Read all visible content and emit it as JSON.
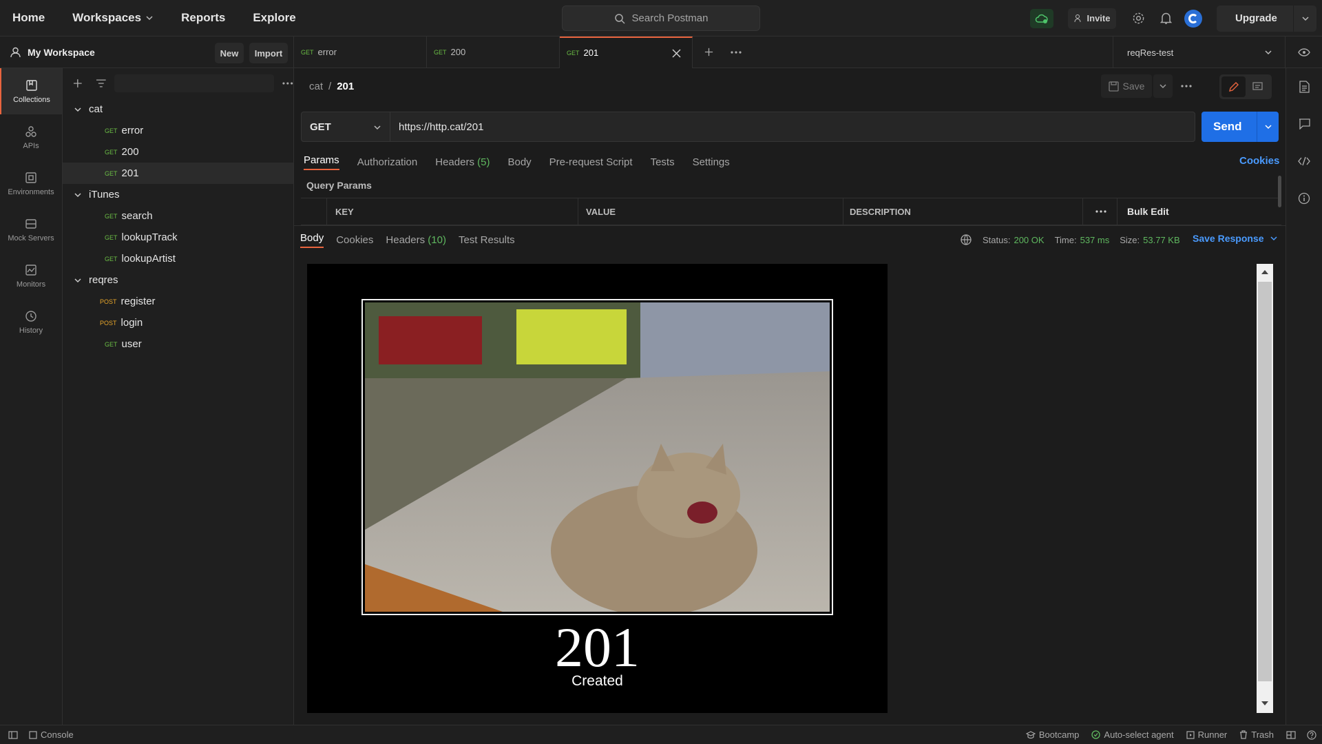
{
  "topnav": {
    "home": "Home",
    "workspaces": "Workspaces",
    "reports": "Reports",
    "explore": "Explore",
    "search_placeholder": "Search Postman",
    "invite": "Invite",
    "upgrade": "Upgrade"
  },
  "workspace": {
    "name": "My Workspace",
    "new": "New",
    "import": "Import"
  },
  "rail": [
    {
      "label": "Collections",
      "icon": "collections-icon"
    },
    {
      "label": "APIs",
      "icon": "apis-icon"
    },
    {
      "label": "Environments",
      "icon": "environments-icon"
    },
    {
      "label": "Mock Servers",
      "icon": "mock-servers-icon"
    },
    {
      "label": "Monitors",
      "icon": "monitors-icon"
    },
    {
      "label": "History",
      "icon": "history-icon"
    }
  ],
  "collections": [
    {
      "name": "cat",
      "requests": [
        {
          "method": "GET",
          "name": "error"
        },
        {
          "method": "GET",
          "name": "200"
        },
        {
          "method": "GET",
          "name": "201"
        }
      ]
    },
    {
      "name": "iTunes",
      "requests": [
        {
          "method": "GET",
          "name": "search"
        },
        {
          "method": "GET",
          "name": "lookupTrack"
        },
        {
          "method": "GET",
          "name": "lookupArtist"
        }
      ]
    },
    {
      "name": "reqres",
      "requests": [
        {
          "method": "POST",
          "name": "register"
        },
        {
          "method": "POST",
          "name": "login"
        },
        {
          "method": "GET",
          "name": "user"
        }
      ]
    }
  ],
  "tabs": [
    {
      "method": "GET",
      "name": "error"
    },
    {
      "method": "GET",
      "name": "200"
    },
    {
      "method": "GET",
      "name": "201"
    }
  ],
  "environment": "reqRes-test",
  "request": {
    "breadcrumb_parent": "cat",
    "breadcrumb_sep": "/",
    "breadcrumb_current": "201",
    "save": "Save",
    "method": "GET",
    "url": "https://http.cat/201",
    "send": "Send",
    "subtabs": [
      "Params",
      "Authorization",
      "Headers",
      "Body",
      "Pre-request Script",
      "Tests",
      "Settings"
    ],
    "headers_count": "(5)",
    "cookies": "Cookies",
    "query_params": "Query Params",
    "table_headers": {
      "key": "KEY",
      "value": "VALUE",
      "description": "DESCRIPTION",
      "bulk_edit": "Bulk Edit"
    }
  },
  "response": {
    "tabs": [
      "Body",
      "Cookies",
      "Headers",
      "Test Results"
    ],
    "headers_count": "(10)",
    "status_label": "Status:",
    "status_value": "200 OK",
    "time_label": "Time:",
    "time_value": "537 ms",
    "size_label": "Size:",
    "size_value": "53.77 KB",
    "save_response": "Save Response",
    "image_code": "201",
    "image_text": "Created"
  },
  "statusbar": {
    "console": "Console",
    "bootcamp": "Bootcamp",
    "agent": "Auto-select agent",
    "runner": "Runner",
    "trash": "Trash"
  },
  "colors": {
    "accent": "#e8643e",
    "send": "#1f6fe6",
    "get": "#6bbe45",
    "post": "#e6a52a",
    "status_ok": "#5fb85f"
  }
}
